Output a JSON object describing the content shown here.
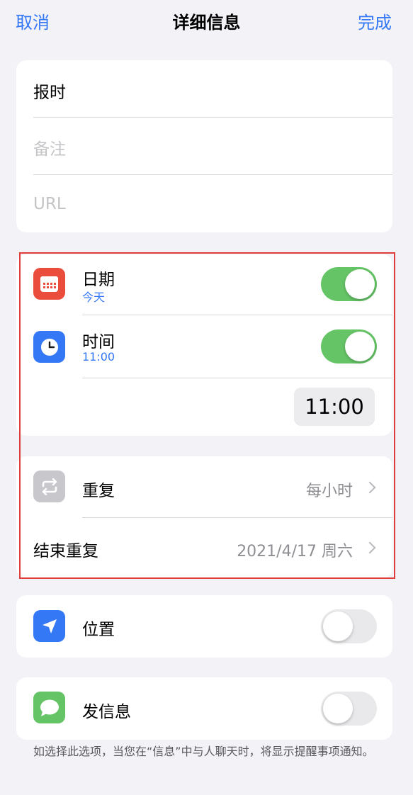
{
  "nav": {
    "cancel": "取消",
    "title": "详细信息",
    "done": "完成"
  },
  "fields": {
    "title_value": "报时",
    "notes_placeholder": "备注",
    "url_placeholder": "URL"
  },
  "date_row": {
    "label": "日期",
    "sub": "今天",
    "toggle_on": true,
    "icon_color": "#eb4d3d"
  },
  "time_row": {
    "label": "时间",
    "sub": "11:00",
    "toggle_on": true,
    "picker_value": "11:00",
    "icon_color": "#3478f6"
  },
  "repeat_row": {
    "label": "重复",
    "value": "每小时",
    "icon_color": "#c7c7cc"
  },
  "end_repeat_row": {
    "label": "结束重复",
    "value": "2021/4/17 周六"
  },
  "location_row": {
    "label": "位置",
    "toggle_on": false,
    "icon_color": "#3478f6"
  },
  "message_row": {
    "label": "发信息",
    "toggle_on": false,
    "icon_color": "#65c466"
  },
  "footer": {
    "note": "如选择此选项，当您在“信息”中与人聊天时，将显示提醒事项通知。"
  },
  "accent_color": "#3478f6",
  "highlight_color": "#e03c3c"
}
